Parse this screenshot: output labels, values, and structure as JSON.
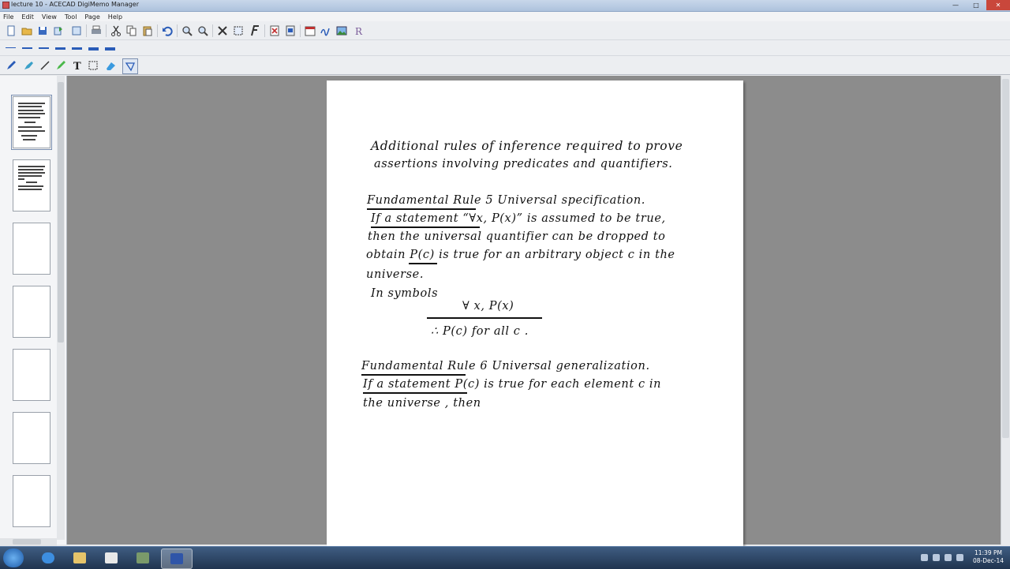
{
  "window": {
    "title": "lecture 10 - ACECAD DigiMemo Manager",
    "buttons": {
      "minimize": "—",
      "maximize": "□",
      "close": "✕"
    }
  },
  "menu": [
    "File",
    "Edit",
    "View",
    "Tool",
    "Page",
    "Help"
  ],
  "page": {
    "lines": [
      "Additional rules of inference required to prove",
      "assertions involving predicates and quantifiers.",
      "Fundamental Rule 5  Universal specification.",
      "If  a  statement  “∀x, P(x)”  is  assumed to be true,",
      "then the universal quantifier can be dropped to",
      "obtain  P(c)  is true for an arbitrary object c in the",
      "universe.",
      "In symbols",
      "∀ x,  P(x)",
      "∴ P(c)   for all  c .",
      "Fundamental Rule 6  Universal generalization.",
      "If  a  statement  P(c)  is  true  for  each  element  c  in",
      "the  universe ,  then"
    ]
  },
  "taskbar": {
    "clock_time": "11:39 PM",
    "clock_date": "08-Dec-14"
  }
}
